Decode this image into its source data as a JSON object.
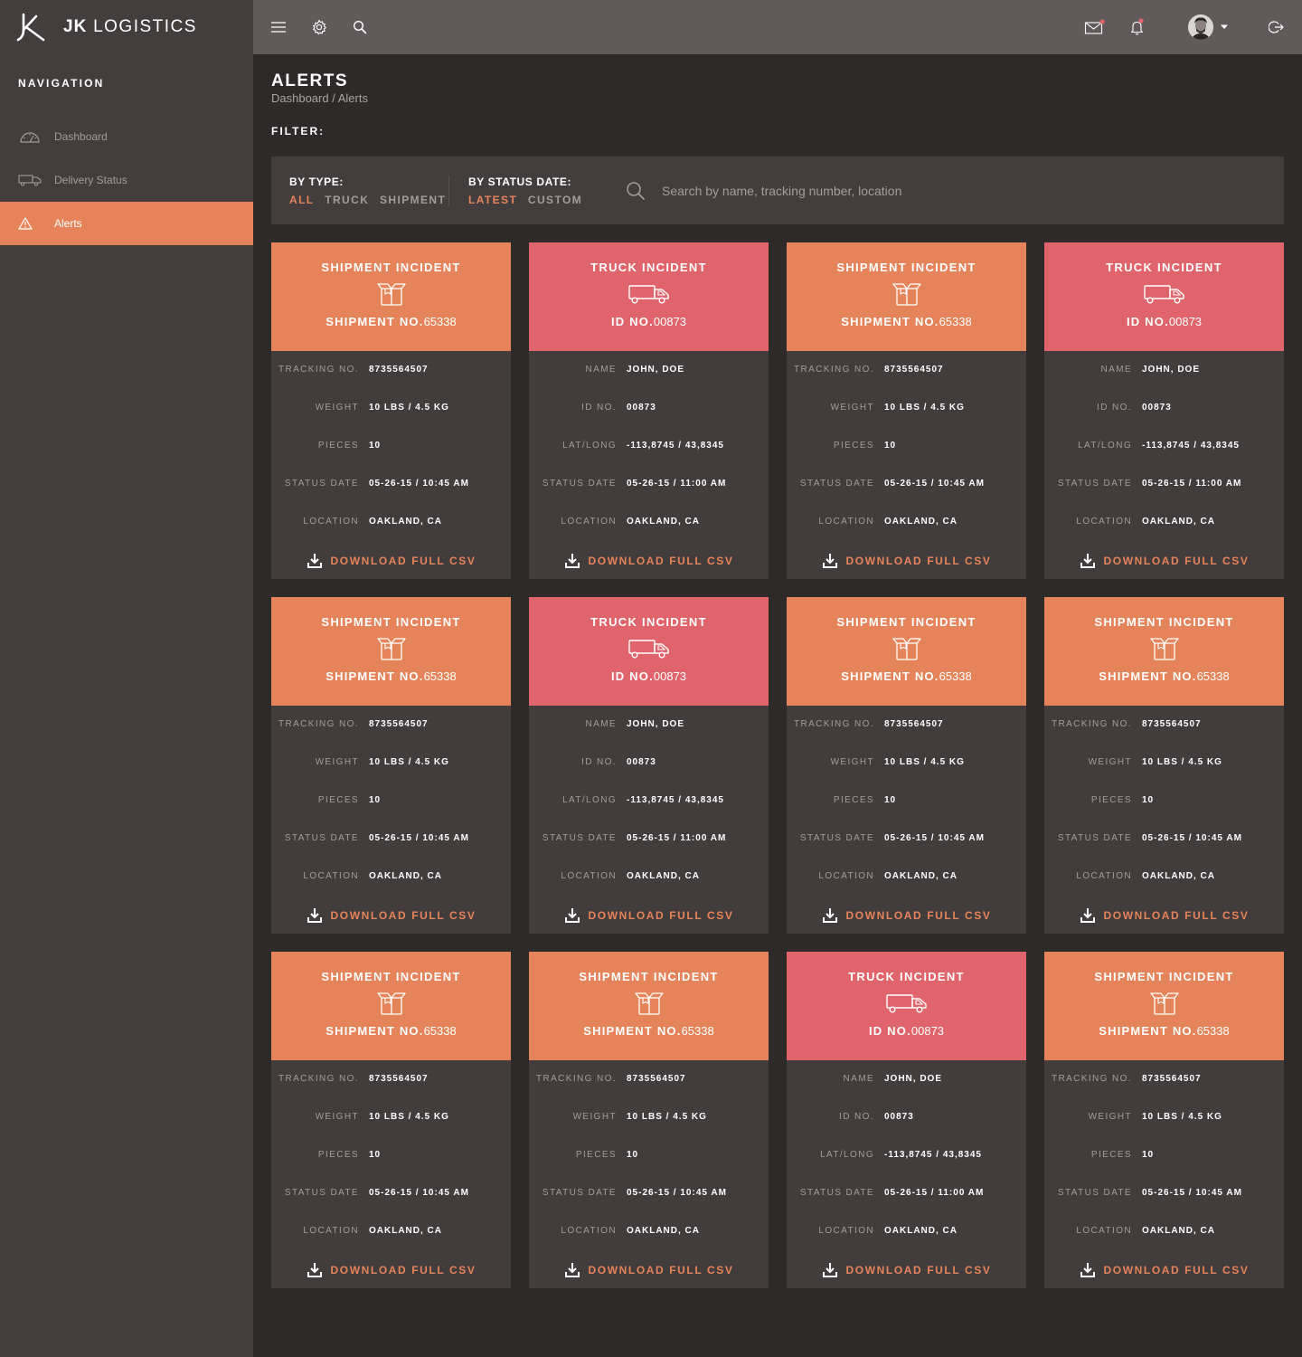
{
  "brand": {
    "bold": "JK",
    "light": "LOGISTICS"
  },
  "navigation": {
    "heading": "NAVIGATION",
    "items": [
      {
        "label": "Dashboard",
        "icon": "speedometer-icon",
        "active": false
      },
      {
        "label": "Delivery Status",
        "icon": "truck-icon",
        "active": false
      },
      {
        "label": "Alerts",
        "icon": "warning-icon",
        "active": true
      }
    ]
  },
  "topbar": {
    "icons": [
      "menu-icon",
      "gear-icon",
      "search-icon",
      "mail-icon",
      "bell-icon",
      "avatar",
      "logout-icon"
    ]
  },
  "page": {
    "title": "ALERTS",
    "breadcrumb": "Dashboard / Alerts",
    "filter_label": "FILTER:"
  },
  "filters": {
    "by_type": {
      "title": "BY TYPE:",
      "options": [
        "ALL",
        "TRUCK",
        "SHIPMENT"
      ],
      "selected": "ALL"
    },
    "by_status_date": {
      "title": "BY STATUS DATE:",
      "options": [
        "LATEST",
        "CUSTOM"
      ],
      "selected": "LATEST"
    },
    "search_placeholder": "Search by name, tracking number, location"
  },
  "colors": {
    "accent": "#e5845a",
    "shipment": "#e5845a",
    "truck": "#e0646b",
    "sidebar": "#443d3d",
    "topbar": "#625a5a",
    "background": "#2f2a2a"
  },
  "download_label": "DOWNLOAD FULL CSV",
  "cards": [
    {
      "kind": "shipment",
      "type": "SHIPMENT INCIDENT",
      "num_label": "SHIPMENT NO.",
      "num_value": "65338",
      "rows": [
        [
          "TRACKING NO.",
          "8735564507"
        ],
        [
          "WEIGHT",
          "10 LBS / 4.5 KG"
        ],
        [
          "PIECES",
          "10"
        ],
        [
          "STATUS DATE",
          "05-26-15 / 10:45 AM"
        ],
        [
          "LOCATION",
          "OAKLAND, CA"
        ]
      ]
    },
    {
      "kind": "truck",
      "type": "TRUCK INCIDENT",
      "num_label": "ID NO.",
      "num_value": "00873",
      "rows": [
        [
          "NAME",
          "JOHN, DOE"
        ],
        [
          "ID NO.",
          "00873"
        ],
        [
          "LAT/LONG",
          "-113,8745 / 43,8345"
        ],
        [
          "STATUS DATE",
          "05-26-15 / 11:00 AM"
        ],
        [
          "LOCATION",
          "OAKLAND, CA"
        ]
      ]
    },
    {
      "kind": "shipment",
      "type": "SHIPMENT INCIDENT",
      "num_label": "SHIPMENT NO.",
      "num_value": "65338",
      "rows": [
        [
          "TRACKING NO.",
          "8735564507"
        ],
        [
          "WEIGHT",
          "10 LBS / 4.5 KG"
        ],
        [
          "PIECES",
          "10"
        ],
        [
          "STATUS DATE",
          "05-26-15 / 10:45 AM"
        ],
        [
          "LOCATION",
          "OAKLAND, CA"
        ]
      ]
    },
    {
      "kind": "truck",
      "type": "TRUCK INCIDENT",
      "num_label": "ID NO.",
      "num_value": "00873",
      "rows": [
        [
          "NAME",
          "JOHN, DOE"
        ],
        [
          "ID NO.",
          "00873"
        ],
        [
          "LAT/LONG",
          "-113,8745 / 43,8345"
        ],
        [
          "STATUS DATE",
          "05-26-15 / 11:00 AM"
        ],
        [
          "LOCATION",
          "OAKLAND, CA"
        ]
      ]
    },
    {
      "kind": "shipment",
      "type": "SHIPMENT INCIDENT",
      "num_label": "SHIPMENT NO.",
      "num_value": "65338",
      "rows": [
        [
          "TRACKING NO.",
          "8735564507"
        ],
        [
          "WEIGHT",
          "10 LBS / 4.5 KG"
        ],
        [
          "PIECES",
          "10"
        ],
        [
          "STATUS DATE",
          "05-26-15 / 10:45 AM"
        ],
        [
          "LOCATION",
          "OAKLAND, CA"
        ]
      ]
    },
    {
      "kind": "truck",
      "type": "TRUCK INCIDENT",
      "num_label": "ID NO.",
      "num_value": "00873",
      "rows": [
        [
          "NAME",
          "JOHN, DOE"
        ],
        [
          "ID NO.",
          "00873"
        ],
        [
          "LAT/LONG",
          "-113,8745 / 43,8345"
        ],
        [
          "STATUS DATE",
          "05-26-15 / 11:00 AM"
        ],
        [
          "LOCATION",
          "OAKLAND, CA"
        ]
      ]
    },
    {
      "kind": "shipment",
      "type": "SHIPMENT INCIDENT",
      "num_label": "SHIPMENT NO.",
      "num_value": "65338",
      "rows": [
        [
          "TRACKING NO.",
          "8735564507"
        ],
        [
          "WEIGHT",
          "10 LBS / 4.5 KG"
        ],
        [
          "PIECES",
          "10"
        ],
        [
          "STATUS DATE",
          "05-26-15 / 10:45 AM"
        ],
        [
          "LOCATION",
          "OAKLAND, CA"
        ]
      ]
    },
    {
      "kind": "shipment",
      "type": "SHIPMENT INCIDENT",
      "num_label": "SHIPMENT NO.",
      "num_value": "65338",
      "rows": [
        [
          "TRACKING NO.",
          "8735564507"
        ],
        [
          "WEIGHT",
          "10 LBS / 4.5 KG"
        ],
        [
          "PIECES",
          "10"
        ],
        [
          "STATUS DATE",
          "05-26-15 / 10:45 AM"
        ],
        [
          "LOCATION",
          "OAKLAND, CA"
        ]
      ]
    },
    {
      "kind": "shipment",
      "type": "SHIPMENT INCIDENT",
      "num_label": "SHIPMENT NO.",
      "num_value": "65338",
      "rows": [
        [
          "TRACKING NO.",
          "8735564507"
        ],
        [
          "WEIGHT",
          "10 LBS / 4.5 KG"
        ],
        [
          "PIECES",
          "10"
        ],
        [
          "STATUS DATE",
          "05-26-15 / 10:45 AM"
        ],
        [
          "LOCATION",
          "OAKLAND, CA"
        ]
      ]
    },
    {
      "kind": "shipment",
      "type": "SHIPMENT INCIDENT",
      "num_label": "SHIPMENT NO.",
      "num_value": "65338",
      "rows": [
        [
          "TRACKING NO.",
          "8735564507"
        ],
        [
          "WEIGHT",
          "10 LBS / 4.5 KG"
        ],
        [
          "PIECES",
          "10"
        ],
        [
          "STATUS DATE",
          "05-26-15 / 10:45 AM"
        ],
        [
          "LOCATION",
          "OAKLAND, CA"
        ]
      ]
    },
    {
      "kind": "truck",
      "type": "TRUCK INCIDENT",
      "num_label": "ID NO.",
      "num_value": "00873",
      "rows": [
        [
          "NAME",
          "JOHN, DOE"
        ],
        [
          "ID NO.",
          "00873"
        ],
        [
          "LAT/LONG",
          "-113,8745 / 43,8345"
        ],
        [
          "STATUS DATE",
          "05-26-15 / 11:00 AM"
        ],
        [
          "LOCATION",
          "OAKLAND, CA"
        ]
      ]
    },
    {
      "kind": "shipment",
      "type": "SHIPMENT INCIDENT",
      "num_label": "SHIPMENT NO.",
      "num_value": "65338",
      "rows": [
        [
          "TRACKING NO.",
          "8735564507"
        ],
        [
          "WEIGHT",
          "10 LBS / 4.5 KG"
        ],
        [
          "PIECES",
          "10"
        ],
        [
          "STATUS DATE",
          "05-26-15 / 10:45 AM"
        ],
        [
          "LOCATION",
          "OAKLAND, CA"
        ]
      ]
    }
  ]
}
